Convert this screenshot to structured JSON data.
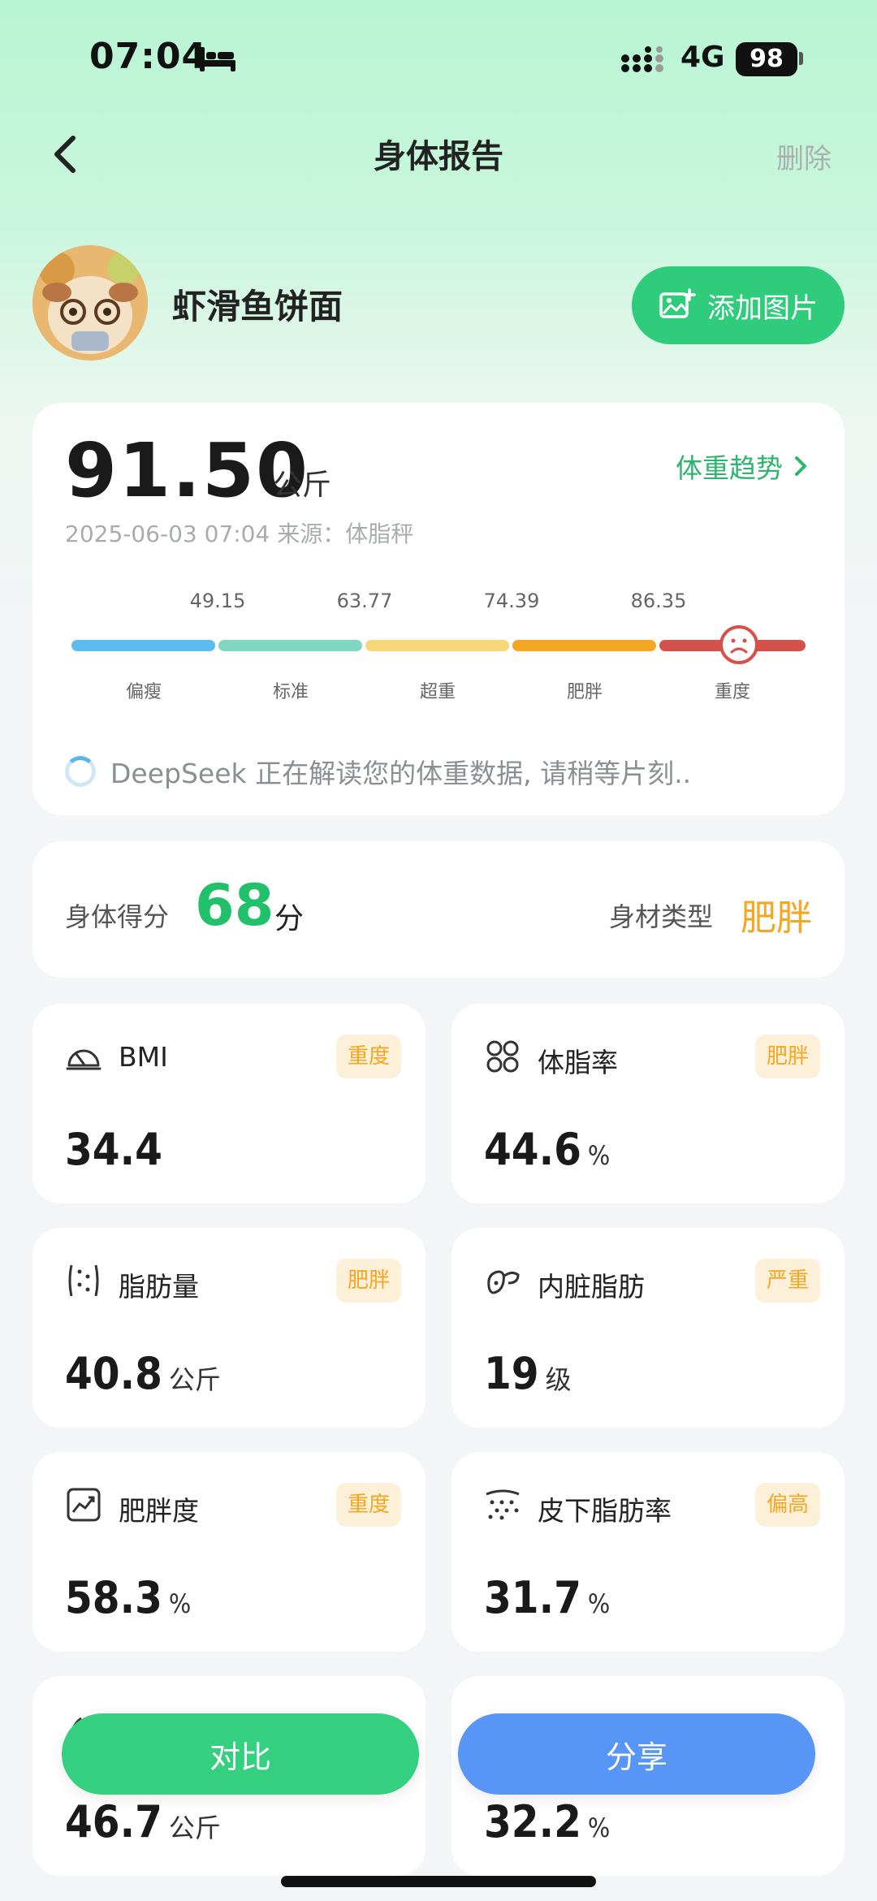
{
  "status_bar": {
    "time": "07:04",
    "network": "4G",
    "battery": "98"
  },
  "nav": {
    "title": "身体报告",
    "delete_label": "删除"
  },
  "profile": {
    "username": "虾滑鱼饼面",
    "add_image_label": "添加图片"
  },
  "weight": {
    "value": "91.50",
    "unit": "公斤",
    "trend_label": "体重趋势",
    "meta": "2025-06-03 07:04 来源：体脂秤",
    "scale": {
      "thresholds": [
        "49.15",
        "63.77",
        "74.39",
        "86.35"
      ],
      "labels": [
        "偏瘦",
        "标准",
        "超重",
        "肥胖",
        "重度"
      ],
      "colors": [
        "#5bbcf0",
        "#7fd6c2",
        "#f7d77a",
        "#f5a623",
        "#d4524a"
      ],
      "current_level": "重度"
    },
    "ai_status": "DeepSeek 正在解读您的体重数据, 请稍等片刻.."
  },
  "score": {
    "label": "身体得分",
    "value": "68",
    "unit": "分",
    "bodytype_label": "身材类型",
    "bodytype_value": "肥胖"
  },
  "metrics": [
    {
      "name": "BMI",
      "badge": "重度",
      "value": "34.4",
      "unit": "",
      "icon": "gauge-icon"
    },
    {
      "name": "体脂率",
      "badge": "肥胖",
      "value": "44.6",
      "unit": "%",
      "icon": "fat-cells-icon"
    },
    {
      "name": "脂肪量",
      "badge": "肥胖",
      "value": "40.8",
      "unit": "公斤",
      "icon": "fat-mass-icon"
    },
    {
      "name": "内脏脂肪",
      "badge": "严重",
      "value": "19",
      "unit": "级",
      "icon": "organ-icon"
    },
    {
      "name": "肥胖度",
      "badge": "重度",
      "value": "58.3",
      "unit": "%",
      "icon": "trend-chart-icon"
    },
    {
      "name": "皮下脂肪率",
      "badge": "偏高",
      "value": "31.7",
      "unit": "%",
      "icon": "subcutaneous-icon"
    },
    {
      "name": "",
      "badge": "",
      "value": "46.7",
      "unit": "公斤",
      "icon": "muscle-icon"
    },
    {
      "name": "",
      "badge": "",
      "value": "32.2",
      "unit": "%",
      "icon": "water-icon"
    }
  ],
  "actions": {
    "compare_label": "对比",
    "share_label": "分享"
  },
  "colors": {
    "accent_green": "#2fcc7c",
    "score_green": "#21c06a",
    "warning_orange": "#f5a623",
    "share_blue": "#5796f7"
  }
}
